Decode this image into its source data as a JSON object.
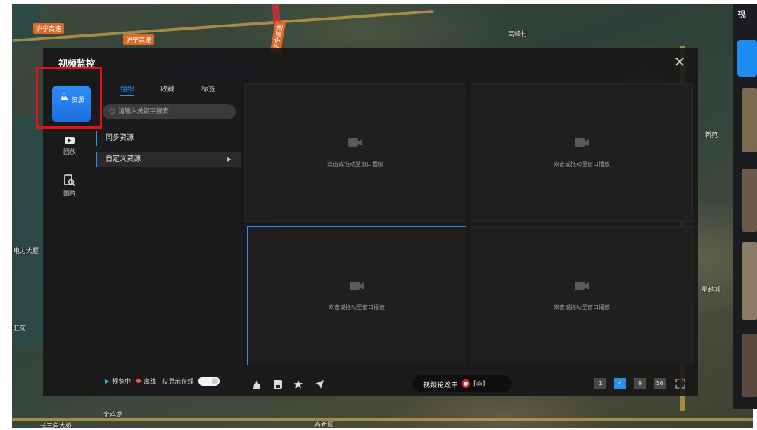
{
  "map": {
    "road_labels": [
      "沪宁高速",
      "沪宁高速",
      "沪宁高速"
    ],
    "place_labels": [
      "高峰村",
      "电力大厦",
      "汇苑",
      "星越城",
      "新苑"
    ],
    "bottom_labels": [
      "长三角大桥",
      "金鸡湖",
      "高新区"
    ]
  },
  "right_strip": {
    "title": "视"
  },
  "modal": {
    "title": "视频监控",
    "close_icon": "close-icon"
  },
  "rail": {
    "items": [
      {
        "label": "资源",
        "icon": "resource-icon",
        "active": true
      },
      {
        "label": "回放",
        "icon": "playback-icon",
        "active": false
      },
      {
        "label": "图片",
        "icon": "image-search-icon",
        "active": false
      }
    ]
  },
  "resource_panel": {
    "tabs": [
      "组织",
      "收藏",
      "标签"
    ],
    "active_tab": "组织",
    "search_placeholder": "请输入关键字搜索",
    "tree": [
      {
        "label": "同步资源",
        "has_children": false
      },
      {
        "label": "自定义资源",
        "has_children": true
      }
    ]
  },
  "legend": {
    "previewing": "预览中",
    "offline": "离线",
    "only_online": "仅显示在线",
    "only_online_enabled": true
  },
  "grid": {
    "cell_hint": "双击或拖动至窗口播放",
    "cells": 4,
    "selected_index": 2
  },
  "toolbar": {
    "icons": [
      "snapshot-icon",
      "save-icon",
      "star-icon",
      "send-icon"
    ],
    "polling_label": "视频轮巡中",
    "polling_icons": [
      "record-icon",
      "focus-icon"
    ]
  },
  "pager": {
    "options": [
      "1",
      "4",
      "9",
      "16"
    ],
    "active": "4"
  },
  "colors": {
    "accent": "#2f8cf5",
    "selected_border": "#2c8ee8",
    "highlight_box": "#e3101e",
    "offline_dot": "#e8604a",
    "preview_dot": "#28c0d8"
  }
}
